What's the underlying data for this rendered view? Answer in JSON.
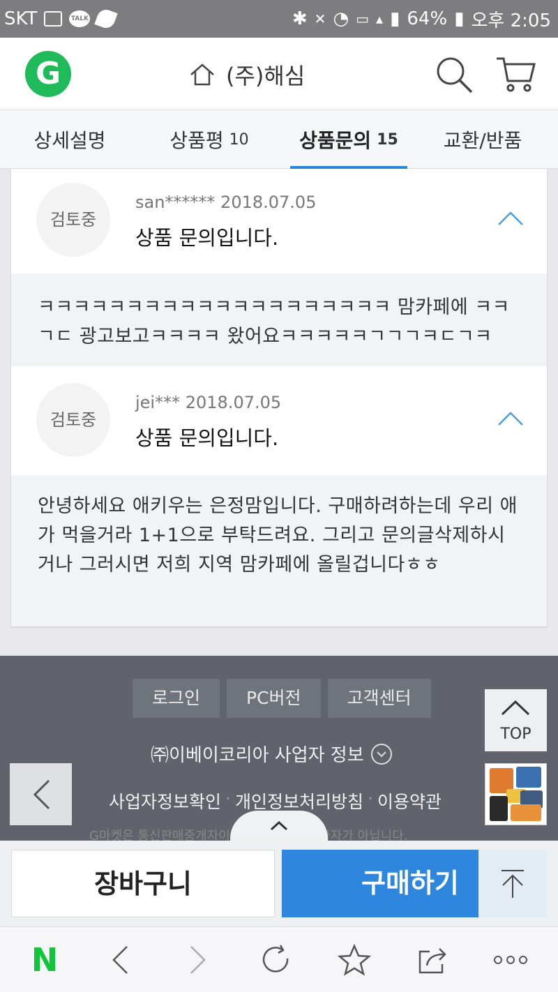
{
  "status_bar": {
    "carrier": "SKT",
    "talk_label": "TALK",
    "battery": "64%",
    "time": "오후 2:05",
    "icons": [
      "image-icon",
      "talk-icon",
      "leaf-icon",
      "bluetooth-icon",
      "mute-icon",
      "alarm-icon",
      "hd-voice-icon",
      "lte-icon",
      "signal-icon",
      "battery-icon"
    ]
  },
  "header": {
    "logo": "G",
    "title": "(주)해심",
    "brand_color": "#1fba5a"
  },
  "tabs": [
    {
      "label": "상세설명",
      "count": ""
    },
    {
      "label": "상품평",
      "count": "10"
    },
    {
      "label": "상품문의",
      "count": "15"
    },
    {
      "label": "교환/반품",
      "count": ""
    }
  ],
  "qna": [
    {
      "status": "검토중",
      "meta": "san****** 2018.07.05",
      "title": "상품 문의입니다.",
      "body": "ㅋㅋㅋㅋㅋㅋㅋㅋㅋㅋㅋㅋㅋㅋㅋㅋㅋㅋㅋㅋ 맘카페에 ㅋㅋㄱㄷ 광고보고ㅋㅋㅋㅋ 왔어요ㅋㅋㅋㅋㅋㄱㄱㄱㅋㄷㄱㅋ"
    },
    {
      "status": "검토중",
      "meta": "jei*** 2018.07.05",
      "title": "상품 문의입니다.",
      "body": "안녕하세요 애키우는 은정맘입니다. 구매하려하는데 우리 애가 먹을거라 1+1으로 부탁드려요. 그리고 문의글삭제하시거나 그러시면 저희 지역 맘카페에 올릴겁니다ㅎㅎ"
    }
  ],
  "footer": {
    "buttons": [
      "로그인",
      "PC버전",
      "고객센터"
    ],
    "business_info": "㈜이베이코리아 사업자 정보",
    "links": [
      "사업자정보확인",
      "개인정보처리방침",
      "이용약관"
    ],
    "notice": "G마켓은 통신판매중개자이며 통신판매의 당사자가 아닙니다.",
    "top_label": "TOP"
  },
  "buy_bar": {
    "cart_label": "장바구니",
    "buy_label": "구매하기",
    "accent": "#2e86de"
  },
  "browser_nav": {
    "logo": "N"
  }
}
